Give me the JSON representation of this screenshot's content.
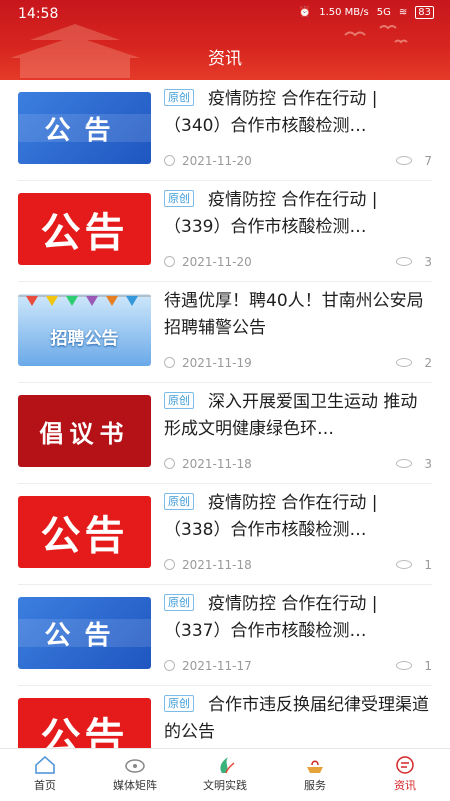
{
  "status_bar": {
    "time": "14:58",
    "speed": "1.50 MB/s",
    "network": "5G",
    "battery": "83"
  },
  "header": {
    "title": "资讯"
  },
  "articles": [
    {
      "thumb_text": "公告",
      "tag": "原创",
      "title": "疫情防控  合作在行动 |（340）合作市核酸检测…",
      "date": "2021-11-20",
      "views": "7"
    },
    {
      "thumb_text": "公告",
      "tag": "原创",
      "title": "疫情防控  合作在行动 |（339）合作市核酸检测…",
      "date": "2021-11-20",
      "views": "3"
    },
    {
      "thumb_text": "招聘公告",
      "tag": "",
      "title": "待遇优厚！聘40人！甘南州公安局招聘辅警公告",
      "date": "2021-11-19",
      "views": "2"
    },
    {
      "thumb_text": "倡议书",
      "tag": "原创",
      "title": "深入开展爱国卫生运动 推动形成文明健康绿色环…",
      "date": "2021-11-18",
      "views": "3"
    },
    {
      "thumb_text": "公告",
      "tag": "原创",
      "title": "疫情防控  合作在行动 |（338）合作市核酸检测…",
      "date": "2021-11-18",
      "views": "1"
    },
    {
      "thumb_text": "公告",
      "tag": "原创",
      "title": "疫情防控  合作在行动 |（337）合作市核酸检测…",
      "date": "2021-11-17",
      "views": "1"
    },
    {
      "thumb_text": "公告",
      "tag": "原创",
      "title": "合作市违反换届纪律受理渠道的公告",
      "date": "",
      "views": ""
    }
  ],
  "tabbar": {
    "home": "首页",
    "media": "媒体矩阵",
    "civilization": "文明实践",
    "service": "服务",
    "news": "资讯"
  },
  "colors": {
    "brand_red": "#d32626",
    "tag_blue": "#3b9ad8"
  }
}
